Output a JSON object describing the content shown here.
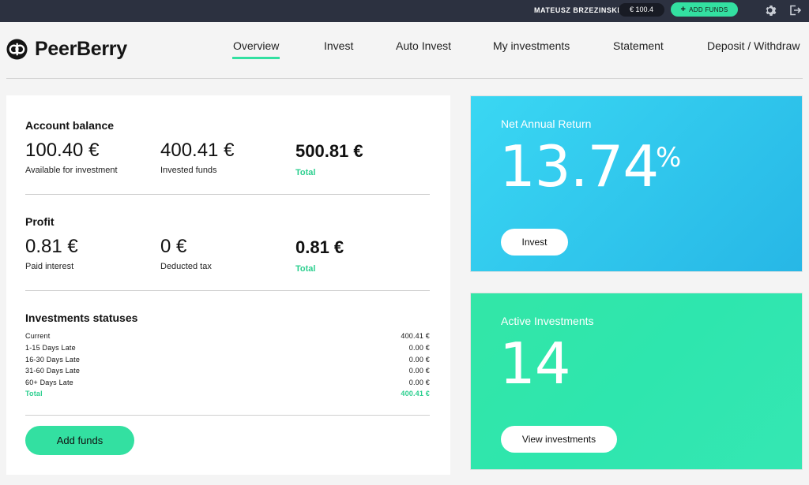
{
  "topbar": {
    "user_name": "MATEUSZ BRZEZINSKI",
    "balance": "€ 100.4",
    "add_funds_label": "ADD FUNDS",
    "icons": [
      "plus-icon",
      "gear-icon",
      "logout-icon"
    ]
  },
  "brand": {
    "name": "PeerBerry"
  },
  "nav": {
    "items": [
      "Overview",
      "Invest",
      "Auto Invest",
      "My investments",
      "Statement",
      "Deposit / Withdraw"
    ],
    "active": "Overview",
    "accent_color": "#33e0a1"
  },
  "account_balance": {
    "title": "Account balance",
    "available_value": "100.40 €",
    "available_label": "Available for investment",
    "invested_value": "400.41 €",
    "invested_label": "Invested funds",
    "total_value": "500.81 €",
    "total_label": "Total"
  },
  "profit": {
    "title": "Profit",
    "paid_value": "0.81 €",
    "paid_label": "Paid interest",
    "tax_value": "0 €",
    "tax_label": "Deducted tax",
    "total_value": "0.81 €",
    "total_label": "Total"
  },
  "statuses": {
    "title": "Investments statuses",
    "rows": [
      {
        "label": "Current",
        "value": "400.41 €"
      },
      {
        "label": "1-15 Days Late",
        "value": "0.00 €"
      },
      {
        "label": "16-30 Days Late",
        "value": "0.00 €"
      },
      {
        "label": "31-60 Days Late",
        "value": "0.00 €"
      },
      {
        "label": "60+ Days Late",
        "value": "0.00 €"
      }
    ],
    "total_label": "Total",
    "total_value": "400.41 €"
  },
  "add_funds_button": "Add funds",
  "net_annual_return": {
    "title": "Net Annual Return",
    "value": "13.74",
    "unit": "%",
    "button": "Invest",
    "color": "#27b7e6"
  },
  "active_investments": {
    "title": "Active Investments",
    "value": "14",
    "button": "View investments",
    "color": "#33e6a7"
  }
}
